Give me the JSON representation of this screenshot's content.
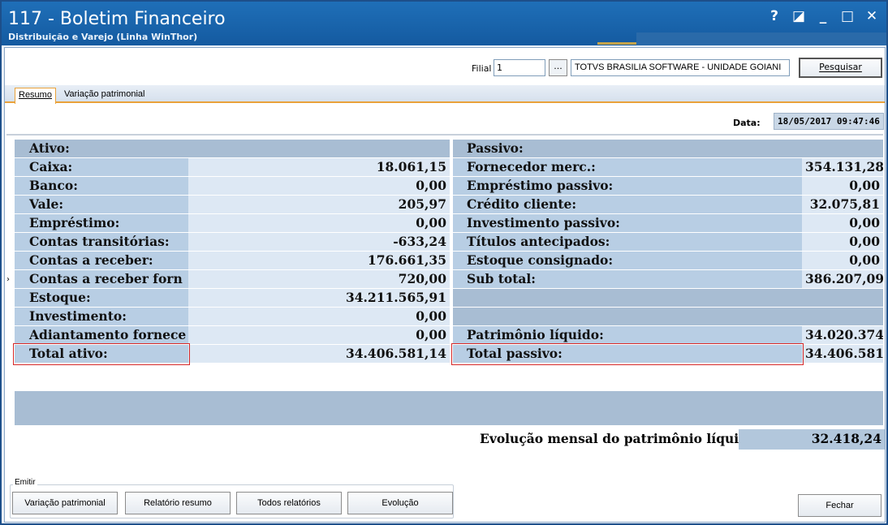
{
  "window": {
    "title": "117 - Boletim Financeiro",
    "subtitle": "Distribuição e Varejo (Linha WinThor)",
    "controls": [
      "?",
      "◪",
      "_",
      "□",
      "✕"
    ]
  },
  "filter": {
    "filial_label": "Filial",
    "filial_code": "1",
    "lookup_label": "...",
    "filial_name": "TOTVS BRASILIA SOFTWARE - UNIDADE GOIANI",
    "search_label": "Pesquisar"
  },
  "tabs": [
    {
      "label": "Resumo",
      "active": true
    },
    {
      "label": "Variação patrimonial",
      "active": false
    }
  ],
  "date": {
    "label": "Data:",
    "value": "18/05/2017 09:47:46"
  },
  "ativo": {
    "header": "Ativo:",
    "rows": [
      {
        "label": "Caixa:",
        "value": "18.061,15"
      },
      {
        "label": "Banco:",
        "value": "0,00"
      },
      {
        "label": "Vale:",
        "value": "205,97"
      },
      {
        "label": "Empréstimo:",
        "value": "0,00"
      },
      {
        "label": "Contas transitórias:",
        "value": "-633,24"
      },
      {
        "label": "Contas a receber:",
        "value": "176.661,35"
      },
      {
        "label": "Contas a receber forn",
        "value": "720,00"
      },
      {
        "label": "Estoque:",
        "value": "34.211.565,91"
      },
      {
        "label": "Investimento:",
        "value": "0,00"
      },
      {
        "label": "Adiantamento fornece",
        "value": "0,00"
      }
    ],
    "total_label": "Total ativo:",
    "total_value": "34.406.581,14"
  },
  "passivo": {
    "header": "Passivo:",
    "rows": [
      {
        "label": "Fornecedor merc.:",
        "value": "354.131,28"
      },
      {
        "label": "Empréstimo passivo:",
        "value": "0,00"
      },
      {
        "label": "Crédito cliente:",
        "value": "32.075,81"
      },
      {
        "label": "Investimento passivo:",
        "value": "0,00"
      },
      {
        "label": "Títulos antecipados:",
        "value": "0,00"
      },
      {
        "label": "Estoque consignado:",
        "value": "0,00"
      },
      {
        "label": "Sub total:",
        "value": "386.207,09"
      }
    ],
    "patrimonio_label": "Patrimônio líquido:",
    "patrimonio_value": "34.020.374",
    "total_label": "Total passivo:",
    "total_value": "34.406.581"
  },
  "evolucao": {
    "label": "Evolução mensal do patrimônio líquido:",
    "value": "32.418,24"
  },
  "emitir": {
    "group_label": "Emitir",
    "buttons": [
      "Variação patrimonial",
      "Relatório resumo",
      "Todos relatórios",
      "Evolução"
    ]
  },
  "close_label": "Fechar",
  "colors": {
    "titlebar": "#1f6fb8",
    "label_cell": "#b8cee4",
    "value_cell": "#dde8f4",
    "highlight": "#d62828",
    "tab_accent": "#e9a23b"
  }
}
